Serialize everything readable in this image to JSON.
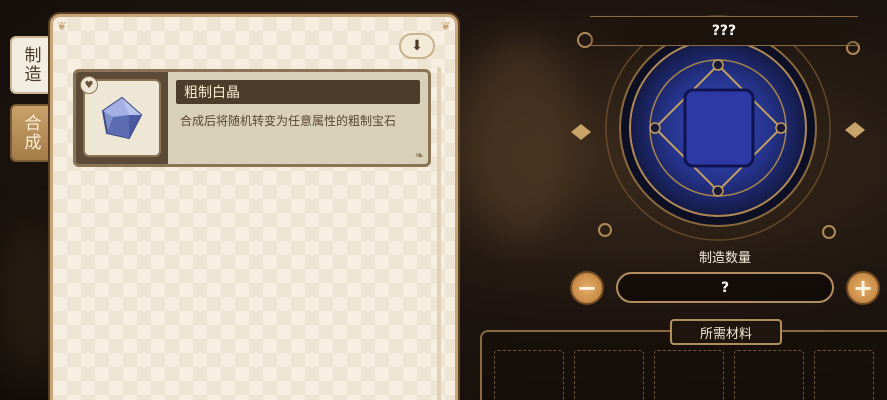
{
  "tabs": {
    "craft_label": "制造",
    "synth_label": "合成"
  },
  "recipe_list": {
    "items": [
      {
        "name": "粗制白晶",
        "description": "合成后将随机转变为任意属性的粗制宝石",
        "icon": "white-crystal-icon"
      }
    ]
  },
  "crafting": {
    "result_name": "???",
    "quantity_label": "制造数量",
    "quantity_value": "?",
    "minus_label": "−",
    "plus_label": "+",
    "materials_label": "所需材料"
  },
  "colors": {
    "panel_bg": "#f6efe1",
    "gold": "#c7a77a",
    "dark_brown": "#4c3c2a",
    "circle_blue": "#2a3a9a"
  }
}
